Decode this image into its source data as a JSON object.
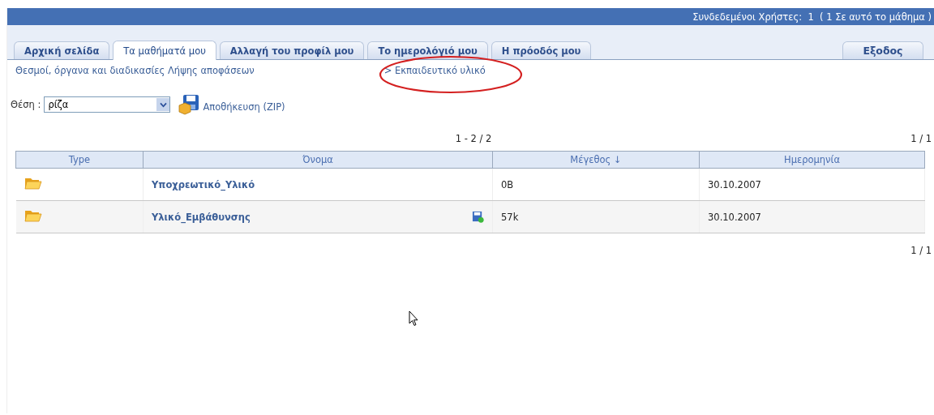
{
  "header": {
    "online_users": "Συνδεδεμένοι Χρήστες:  1  ( 1 Σε αυτό το μάθημα )"
  },
  "tabs": [
    {
      "label": "Αρχική σελίδα",
      "selected": false
    },
    {
      "label": "Τα μαθήματά μου",
      "selected": true
    },
    {
      "label": "Αλλαγή του προφίλ μου",
      "selected": false
    },
    {
      "label": "Το ημερολόγιό μου",
      "selected": false
    },
    {
      "label": "Η πρόοδός μου",
      "selected": false
    }
  ],
  "logout": "Εξοδος",
  "breadcrumb": {
    "course": "Θεσμοί, όργανα και διαδικασίες Λήψης αποφάσεων",
    "section": "> Εκπαιδευτικό υλικό",
    "highlighted": true
  },
  "location": {
    "label": "Θέση :",
    "value": "ρίζα",
    "save_zip": "Αποθήκευση (ZIP)"
  },
  "pager_top": {
    "range": "1 - 2 / 2",
    "pages": "1 / 1"
  },
  "table": {
    "columns": [
      "Type",
      "Όνομα",
      "Μέγεθος ↓",
      "Ημερομηνία"
    ],
    "rows": [
      {
        "kind": "folder",
        "name": "Υποχρεωτικό_Υλικό",
        "downloadable": false,
        "size": "0B",
        "date": "30.10.2007"
      },
      {
        "kind": "folder",
        "name": "Υλικό_Εμβάθυνσης",
        "downloadable": true,
        "size": "57k",
        "date": "30.10.2007"
      }
    ]
  },
  "pager_bottom": {
    "pages": "1 / 1"
  }
}
